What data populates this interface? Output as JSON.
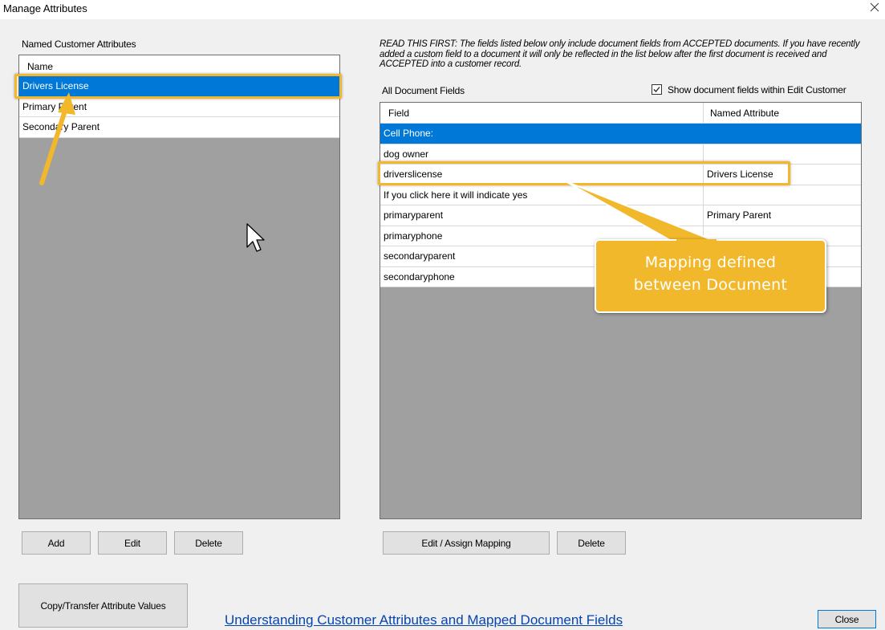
{
  "window": {
    "title": "Manage Attributes",
    "close_icon": "close-x-icon"
  },
  "left": {
    "section_label": "Named Customer Attributes",
    "column_header": "Name",
    "items": [
      {
        "label": "Drivers License",
        "selected": true
      },
      {
        "label": "Primary Parent",
        "selected": false
      },
      {
        "label": "Secondary Parent",
        "selected": false
      }
    ],
    "buttons": {
      "add": "Add",
      "edit": "Edit",
      "delete": "Delete"
    },
    "copy_button": "Copy/Transfer Attribute Values"
  },
  "right": {
    "notice": "READ THIS FIRST:  The fields listed below only include document fields from ACCEPTED documents.  If you have recently added a custom field to a document it will only be reflected in the list below after the first document is received and ACCEPTED into a customer record.",
    "section_label": "All Document Fields",
    "show_checkbox": {
      "label": "Show document fields within Edit Customer",
      "checked": true
    },
    "columns": {
      "field": "Field",
      "named_attribute": "Named Attribute"
    },
    "rows": [
      {
        "field": "Cell Phone:",
        "attribute": "",
        "selected": true
      },
      {
        "field": "dog owner",
        "attribute": "",
        "selected": false
      },
      {
        "field": "driverslicense",
        "attribute": "Drivers License",
        "selected": false
      },
      {
        "field": "If you click here it will indicate yes",
        "attribute": "",
        "selected": false
      },
      {
        "field": "primaryparent",
        "attribute": "Primary Parent",
        "selected": false
      },
      {
        "field": "primaryphone",
        "attribute": "",
        "selected": false
      },
      {
        "field": "secondaryparent",
        "attribute": "",
        "selected": false
      },
      {
        "field": "secondaryphone",
        "attribute": "",
        "selected": false
      }
    ],
    "buttons": {
      "edit_assign": "Edit / Assign Mapping",
      "delete": "Delete"
    }
  },
  "footer": {
    "help_link": "Understanding Customer Attributes and Mapped Document Fields",
    "close_button": "Close"
  },
  "annotation": {
    "callout_line1": "Mapping defined",
    "callout_line2": "between Document",
    "accent_color": "#f2b82b"
  }
}
